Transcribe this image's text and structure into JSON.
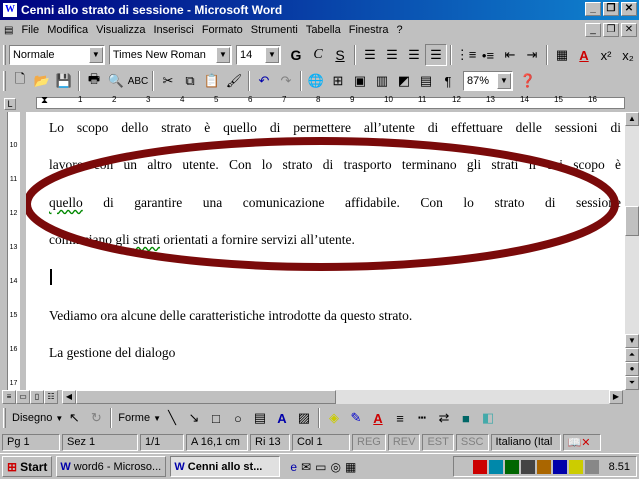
{
  "window": {
    "title": "Cenni allo strato di sessione - Microsoft Word",
    "app_icon": "W"
  },
  "menu": [
    "File",
    "Modifica",
    "Visualizza",
    "Inserisci",
    "Formato",
    "Strumenti",
    "Tabella",
    "Finestra",
    "?"
  ],
  "formatting": {
    "style": "Normale",
    "font": "Times New Roman",
    "size": "14",
    "bold": "G",
    "italic": "C",
    "underline": "S"
  },
  "standard": {
    "zoom": "87%"
  },
  "ruler": {
    "h_ticks": [
      "1",
      "2",
      "3",
      "4",
      "5",
      "6",
      "7",
      "8",
      "9",
      "10",
      "11",
      "12",
      "13",
      "14",
      "15",
      "16"
    ],
    "v_ticks": [
      "10",
      "11",
      "12",
      "13",
      "14",
      "15",
      "16",
      "17"
    ]
  },
  "document": {
    "lines": [
      "Lo scopo dello strato è quello di permettere all’utente di effettuare delle sessioni di",
      "lavoro con un altro utente. Con lo strato di trasporto terminano gli strati il cui scopo è",
      "quello di garantire una comunicazione affidabile. Con lo strato di sessione",
      "cominciano gli strati orientati a fornire servizi all’utente."
    ],
    "paragraph2": "Vediamo ora alcune delle caratteristiche introdotte da questo strato.",
    "paragraph3": "La gestione del dialogo",
    "annotation_color": "#7a0a0a"
  },
  "drawing": {
    "draw_label": "Disegno",
    "shapes_label": "Forme"
  },
  "status": {
    "page": "Pg 1",
    "section": "Sez 1",
    "pages": "1/1",
    "position": "A 16,1 cm",
    "line": "Ri 13",
    "col": "Col 1",
    "rec": "REG",
    "rev": "REV",
    "ext": "EST",
    "ovr": "SSC",
    "language": "Italiano (Ital"
  },
  "taskbar": {
    "start": "Start",
    "tasks": [
      "word6 - Microso...",
      "Cenni allo st..."
    ],
    "clock": "8.51"
  }
}
